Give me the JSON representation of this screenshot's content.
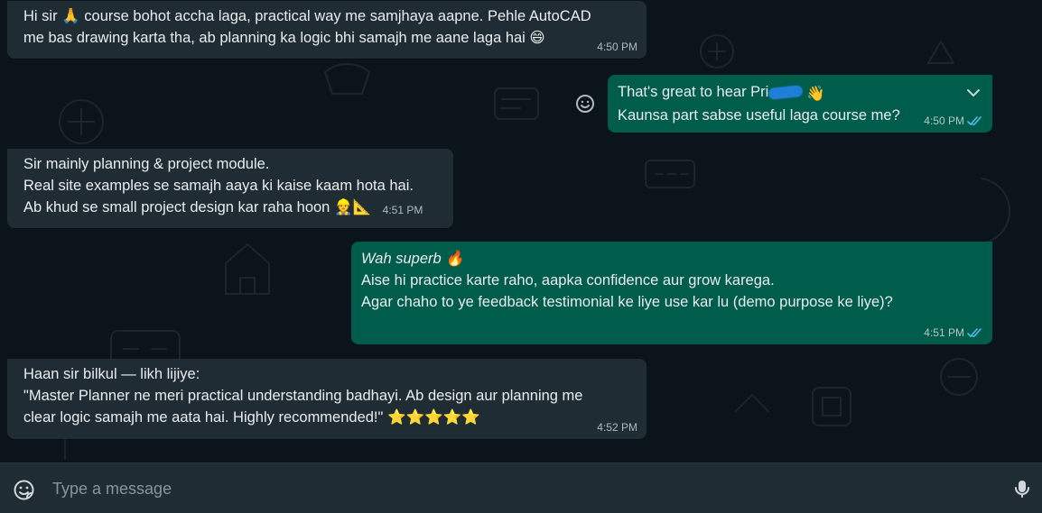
{
  "colors": {
    "background": "#0b141a",
    "incoming_bubble": "#202c33",
    "outgoing_bubble": "#005c4b",
    "text": "#e9edef",
    "meta_text": "#aebac1",
    "read_ticks": "#53bdeb",
    "composer": "#202c33"
  },
  "messages": [
    {
      "direction": "incoming",
      "lines": [
        "Hi sir 🙏 course bohot accha laga, practical way me samjhaya aapne. Pehle AutoCAD",
        "me bas drawing karta tha, ab planning ka logic bhi samajh me aane laga hai 😄"
      ],
      "time": "4:50 PM"
    },
    {
      "direction": "outgoing",
      "line1_prefix": "That's great to hear Pri",
      "line1_suffix": "👋",
      "line2": "Kaunsa part sabse useful laga course me?",
      "time": "4:50 PM",
      "status_icon": "double-check-read-icon"
    },
    {
      "direction": "incoming",
      "lines": [
        "Sir mainly planning & project module.",
        "Real site examples se samajh aaya ki kaise kaam hota hai.",
        "Ab khud se small project design kar raha hoon 👷📐"
      ],
      "time": "4:51 PM"
    },
    {
      "direction": "outgoing",
      "lines": [
        "Wah superb 🔥",
        "Aise hi practice karte raho, aapka confidence aur grow karega.",
        "Agar chaho to ye feedback testimonial ke liye use kar lu (demo purpose ke liye)?"
      ],
      "time": "4:51 PM",
      "status_icon": "double-check-read-icon"
    },
    {
      "direction": "incoming",
      "lines": [
        "Haan sir bilkul — likh lijiye:",
        "\"Master Planner ne meri practical understanding badhayi. Ab design aur planning me",
        "clear logic samajh me aata hai. Highly recommended!\" ⭐⭐⭐⭐⭐"
      ],
      "time": "4:52 PM"
    }
  ],
  "composer": {
    "placeholder": "Type a message",
    "left_icon": "sticker-icon",
    "right_icon": "microphone-icon"
  },
  "icons": {
    "reaction": "emoji-reaction-icon",
    "menu": "chevron-down-icon"
  }
}
